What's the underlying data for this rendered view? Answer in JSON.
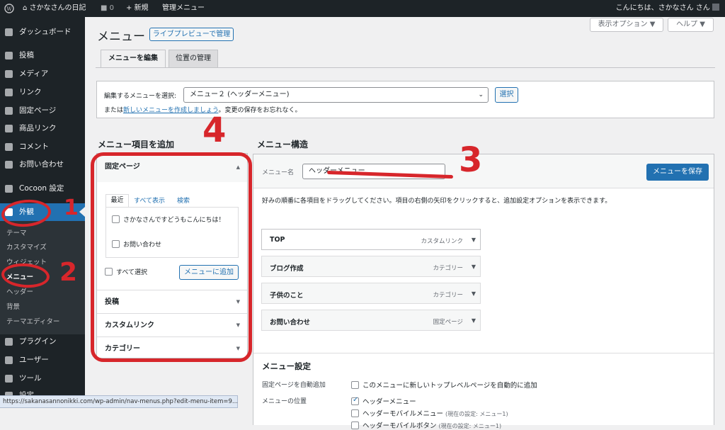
{
  "adminbar": {
    "site_name": "さかなさんの日記",
    "comments_count": "0",
    "new_label": "新規",
    "admin_menu_label": "管理メニュー",
    "greeting": "こんにちは、さかなさん さん"
  },
  "sidebar": {
    "items": [
      {
        "label": "ダッシュボード",
        "icon": "dashboard-icon"
      },
      {
        "label": "投稿",
        "icon": "pin-icon"
      },
      {
        "label": "メディア",
        "icon": "media-icon"
      },
      {
        "label": "リンク",
        "icon": "link-icon"
      },
      {
        "label": "固定ページ",
        "icon": "page-icon"
      },
      {
        "label": "商品リンク",
        "icon": "external-icon"
      },
      {
        "label": "コメント",
        "icon": "comment-icon"
      },
      {
        "label": "お問い合わせ",
        "icon": "mail-icon"
      },
      {
        "label": "Cocoon 設定",
        "icon": "cocoon-icon"
      },
      {
        "label": "外観",
        "icon": "brush-icon"
      },
      {
        "label": "プラグイン",
        "icon": "plugin-icon"
      },
      {
        "label": "ユーザー",
        "icon": "user-icon"
      },
      {
        "label": "ツール",
        "icon": "wrench-icon"
      },
      {
        "label": "設定",
        "icon": "settings-icon"
      }
    ],
    "appearance_sub": [
      "テーマ",
      "カスタマイズ",
      "ウィジェット",
      "メニュー",
      "ヘッダー",
      "背景",
      "テーマエディター"
    ]
  },
  "header": {
    "title": "メニュー",
    "live_preview_button": "ライブプレビューで管理",
    "screen_options": "表示オプション ▼",
    "help": "ヘルプ ▼"
  },
  "tabs": [
    "メニューを編集",
    "位置の管理"
  ],
  "select_menu": {
    "label": "編集するメニューを選択:",
    "selected": "メニュー２ (ヘッダーメニュー)",
    "button": "選択",
    "note_prefix": "または",
    "note_link": "新しいメニューを作成しましょう",
    "note_suffix": "。変更の保存をお忘れなく。"
  },
  "add_items": {
    "heading": "メニュー項目を追加",
    "pages_section": "固定ページ",
    "subtabs": [
      "最近",
      "すべて表示",
      "検索"
    ],
    "pages": [
      "さかなさんですどうもこんにちは！",
      "お問い合わせ"
    ],
    "select_all": "すべて選択",
    "add_button": "メニューに追加",
    "sections": [
      "投稿",
      "カスタムリンク",
      "カテゴリー"
    ]
  },
  "structure": {
    "heading": "メニュー構造",
    "name_label": "メニュー名",
    "name_value": "ヘッダーメニュー",
    "save_button": "メニューを保存",
    "instructions": "好みの順番に各項目をドラッグしてください。項目の右側の矢印をクリックすると、追加設定オプションを表示できます。",
    "items": [
      {
        "title": "TOP",
        "type": "カスタムリンク"
      },
      {
        "title": "ブログ作成",
        "type": "カテゴリー"
      },
      {
        "title": "子供のこと",
        "type": "カテゴリー"
      },
      {
        "title": "お問い合わせ",
        "type": "固定ページ"
      }
    ]
  },
  "settings": {
    "heading": "メニュー設定",
    "auto_add_label": "固定ページを自動追加",
    "auto_add_option": "このメニューに新しいトップレベルページを自動的に追加",
    "location_label": "メニューの位置",
    "locations": [
      {
        "name": "ヘッダーメニュー",
        "note": "",
        "checked": true
      },
      {
        "name": "ヘッダーモバイルメニュー",
        "note": "(現在の設定: メニュー1)",
        "checked": false
      },
      {
        "name": "ヘッダーモバイルボタン",
        "note": "(現在の設定: メニュー1)",
        "checked": false
      }
    ]
  },
  "statusbar": {
    "url": "https://sakanasannonikki.com/wp-admin/nav-menus.php?edit-menu-item=9..."
  },
  "annotations": [
    "1",
    "2",
    "3",
    "4"
  ],
  "colors": {
    "accent": "#2271b1",
    "sidebar": "#1d2327",
    "annotation": "#d7262b"
  }
}
